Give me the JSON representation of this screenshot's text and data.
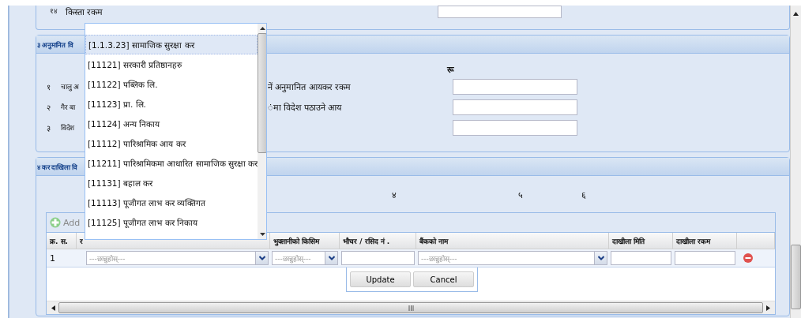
{
  "top_row": {
    "number": "१४",
    "label": "किस्ता रकम"
  },
  "estimate_section": {
    "title": "३ अनुमानित वि",
    "currency_label": "रू",
    "rows": [
      {
        "number": "१",
        "label": "चालु अ",
        "label_right": "नें अनुमानित आयकर रकम"
      },
      {
        "number": "२",
        "label": "गैर बा",
        "label_right": "ंमा विदेश पठाउने आय"
      },
      {
        "number": "३",
        "label": "विदेश"
      }
    ]
  },
  "payment_section": {
    "title": "४ कर दाखिला वि",
    "column_numbers": [
      "४",
      "५",
      "६"
    ],
    "grid": {
      "add_button": "Add",
      "columns": [
        "क्र. स.",
        "र",
        "भुक्तानीको किसिम",
        "भौचर / रसिद नं .",
        "बैंकको नाम",
        "दाखीला मिति",
        "दाखीला रकम"
      ],
      "rows": [
        {
          "number": "1",
          "fields": [
            {
              "kind": "combo",
              "placeholder": "---छान्नुहोस्---"
            },
            {
              "kind": "combo",
              "placeholder": "---छान्नुहोस्---"
            },
            {
              "kind": "input"
            },
            {
              "kind": "combo",
              "placeholder": "---छान्नुहोस्---"
            },
            {
              "kind": "input"
            },
            {
              "kind": "input"
            }
          ]
        }
      ],
      "edit_buttons": [
        "Update",
        "Cancel"
      ]
    }
  },
  "dropdown": {
    "items": [
      {
        "label": "[1.1.3.23] सामाजिक सुरक्षा कर",
        "selected": true
      },
      {
        "label": "[11121] सरकारी प्रतिष्ठानहरु",
        "selected": false
      },
      {
        "label": "[11122] पब्लिक लि.",
        "selected": false
      },
      {
        "label": "[11123] प्रा. लि.",
        "selected": false
      },
      {
        "label": "[11124] अन्य निकाय",
        "selected": false
      },
      {
        "label": "[11112] पारिश्रामिक आय कर",
        "selected": false
      },
      {
        "label": "[11211] पारिश्रामिकमा आधारित सामाजिक सुरक्षा कर",
        "selected": false
      },
      {
        "label": "[11131] बहाल कर",
        "selected": false
      },
      {
        "label": "[11113] पूजीगत लाभ कर व्यक्तिगत",
        "selected": false
      },
      {
        "label": "[11125] पूजीगत लाभ कर निकाय",
        "selected": false
      }
    ]
  }
}
